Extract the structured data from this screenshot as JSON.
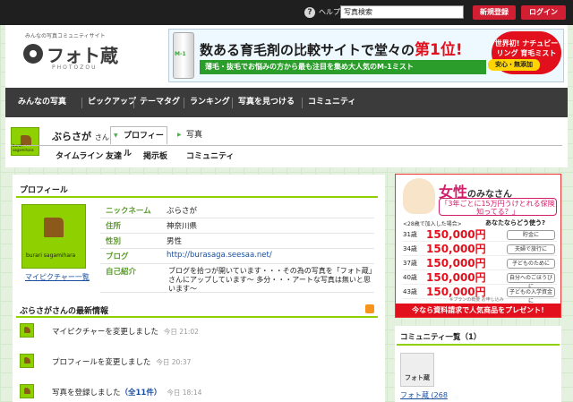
{
  "topbar": {
    "help_label": "ヘルプ",
    "search_value": "写真検索",
    "signup_label": "新規登録",
    "login_label": "ログイン"
  },
  "header": {
    "logo_tagline": "みんなの写真コミュニティサイト",
    "logo_title": "フォト蔵",
    "logo_subtitle": "PHOTOZOU"
  },
  "banner": {
    "headline_prefix": "数ある育毛剤の比較サイトで堂々の",
    "headline_emphasis": "第1位!",
    "subline": "薄毛・抜毛でお悩みの方から最も注目を集め大人気のM-1ミスト",
    "badge_text": "世界初! ナチュビーリング 育毛ミスト",
    "chip_text": "安心・無添加",
    "bottle_label": "M-1"
  },
  "nav": {
    "items": [
      "みんなの写真",
      "ピックアップ",
      "テーマタグ",
      "ランキング",
      "写真を見つける",
      "コミュニティ"
    ]
  },
  "profile_header": {
    "username": "ぶらさが",
    "honorific": "さん",
    "avatar_caption": "burari sagamihara",
    "tab_profile": "プロフィール",
    "tab_photos": "写真",
    "subnav": [
      "タイムライン",
      "友達",
      "掲示板",
      "コミュニティ"
    ],
    "subnav_counts": [
      "",
      "(0)",
      "",
      ""
    ]
  },
  "profile": {
    "section_title": "プロフィール",
    "pic_caption": "burari sagamihara",
    "pic_link": "マイピクチャー一覧",
    "rows": [
      {
        "label": "ニックネーム",
        "value": "ぶらさが"
      },
      {
        "label": "住所",
        "value": "神奈川県"
      },
      {
        "label": "性別",
        "value": "男性"
      },
      {
        "label": "ブログ",
        "value": "http://burasaga.seesaa.net/"
      },
      {
        "label": "自己紹介",
        "value": ""
      }
    ],
    "intro": "ブログを拾つが開いています・・・その為の写真を「フォト蔵」さんにアップしています〜 多分・・・アートな写真は無いと思います〜"
  },
  "activity": {
    "section_title": "ぶらさがさんの最新情報",
    "items": [
      {
        "text": "マイピクチャーを変更しました",
        "time": "今日 21:02"
      },
      {
        "text": "プロフィールを変更しました",
        "time": "今日 20:37"
      },
      {
        "text": "写真を登録しました",
        "count": "（全11件）",
        "time": "今日 18:14"
      }
    ]
  },
  "side_ad": {
    "title": "女性",
    "title_rest": "のみなさん",
    "subtitle": "「3年ごとに15万円うけとれる保険知ってる？」",
    "mini": "<28歳で加入した場合>",
    "question": "あなたならどう使う?",
    "rows": [
      {
        "age": "31歳",
        "amount": "150,000円",
        "note": "貯金に"
      },
      {
        "age": "34歳",
        "amount": "150,000円",
        "note": "夫婦で旅行に"
      },
      {
        "age": "37歳",
        "amount": "150,000円",
        "note": "子どものために"
      },
      {
        "age": "40歳",
        "amount": "150,000円",
        "note": "自分へのごほうびに"
      },
      {
        "age": "43歳",
        "amount": "150,000円",
        "note": "子どもの入学資金に"
      }
    ],
    "copy": "※プランの概要 お申し込み",
    "footer": "今なら資料請求で人気商品をプレゼント!"
  },
  "community": {
    "title": "コミュニティ一覧（1）",
    "thumb_label": "フォト蔵",
    "link": "フォト蔵 (268"
  },
  "colors": {
    "accent_green": "#8fd000",
    "nav_dark": "#3b3b3b",
    "button_red": "#d21e32",
    "link_blue": "#1a4fa0"
  }
}
